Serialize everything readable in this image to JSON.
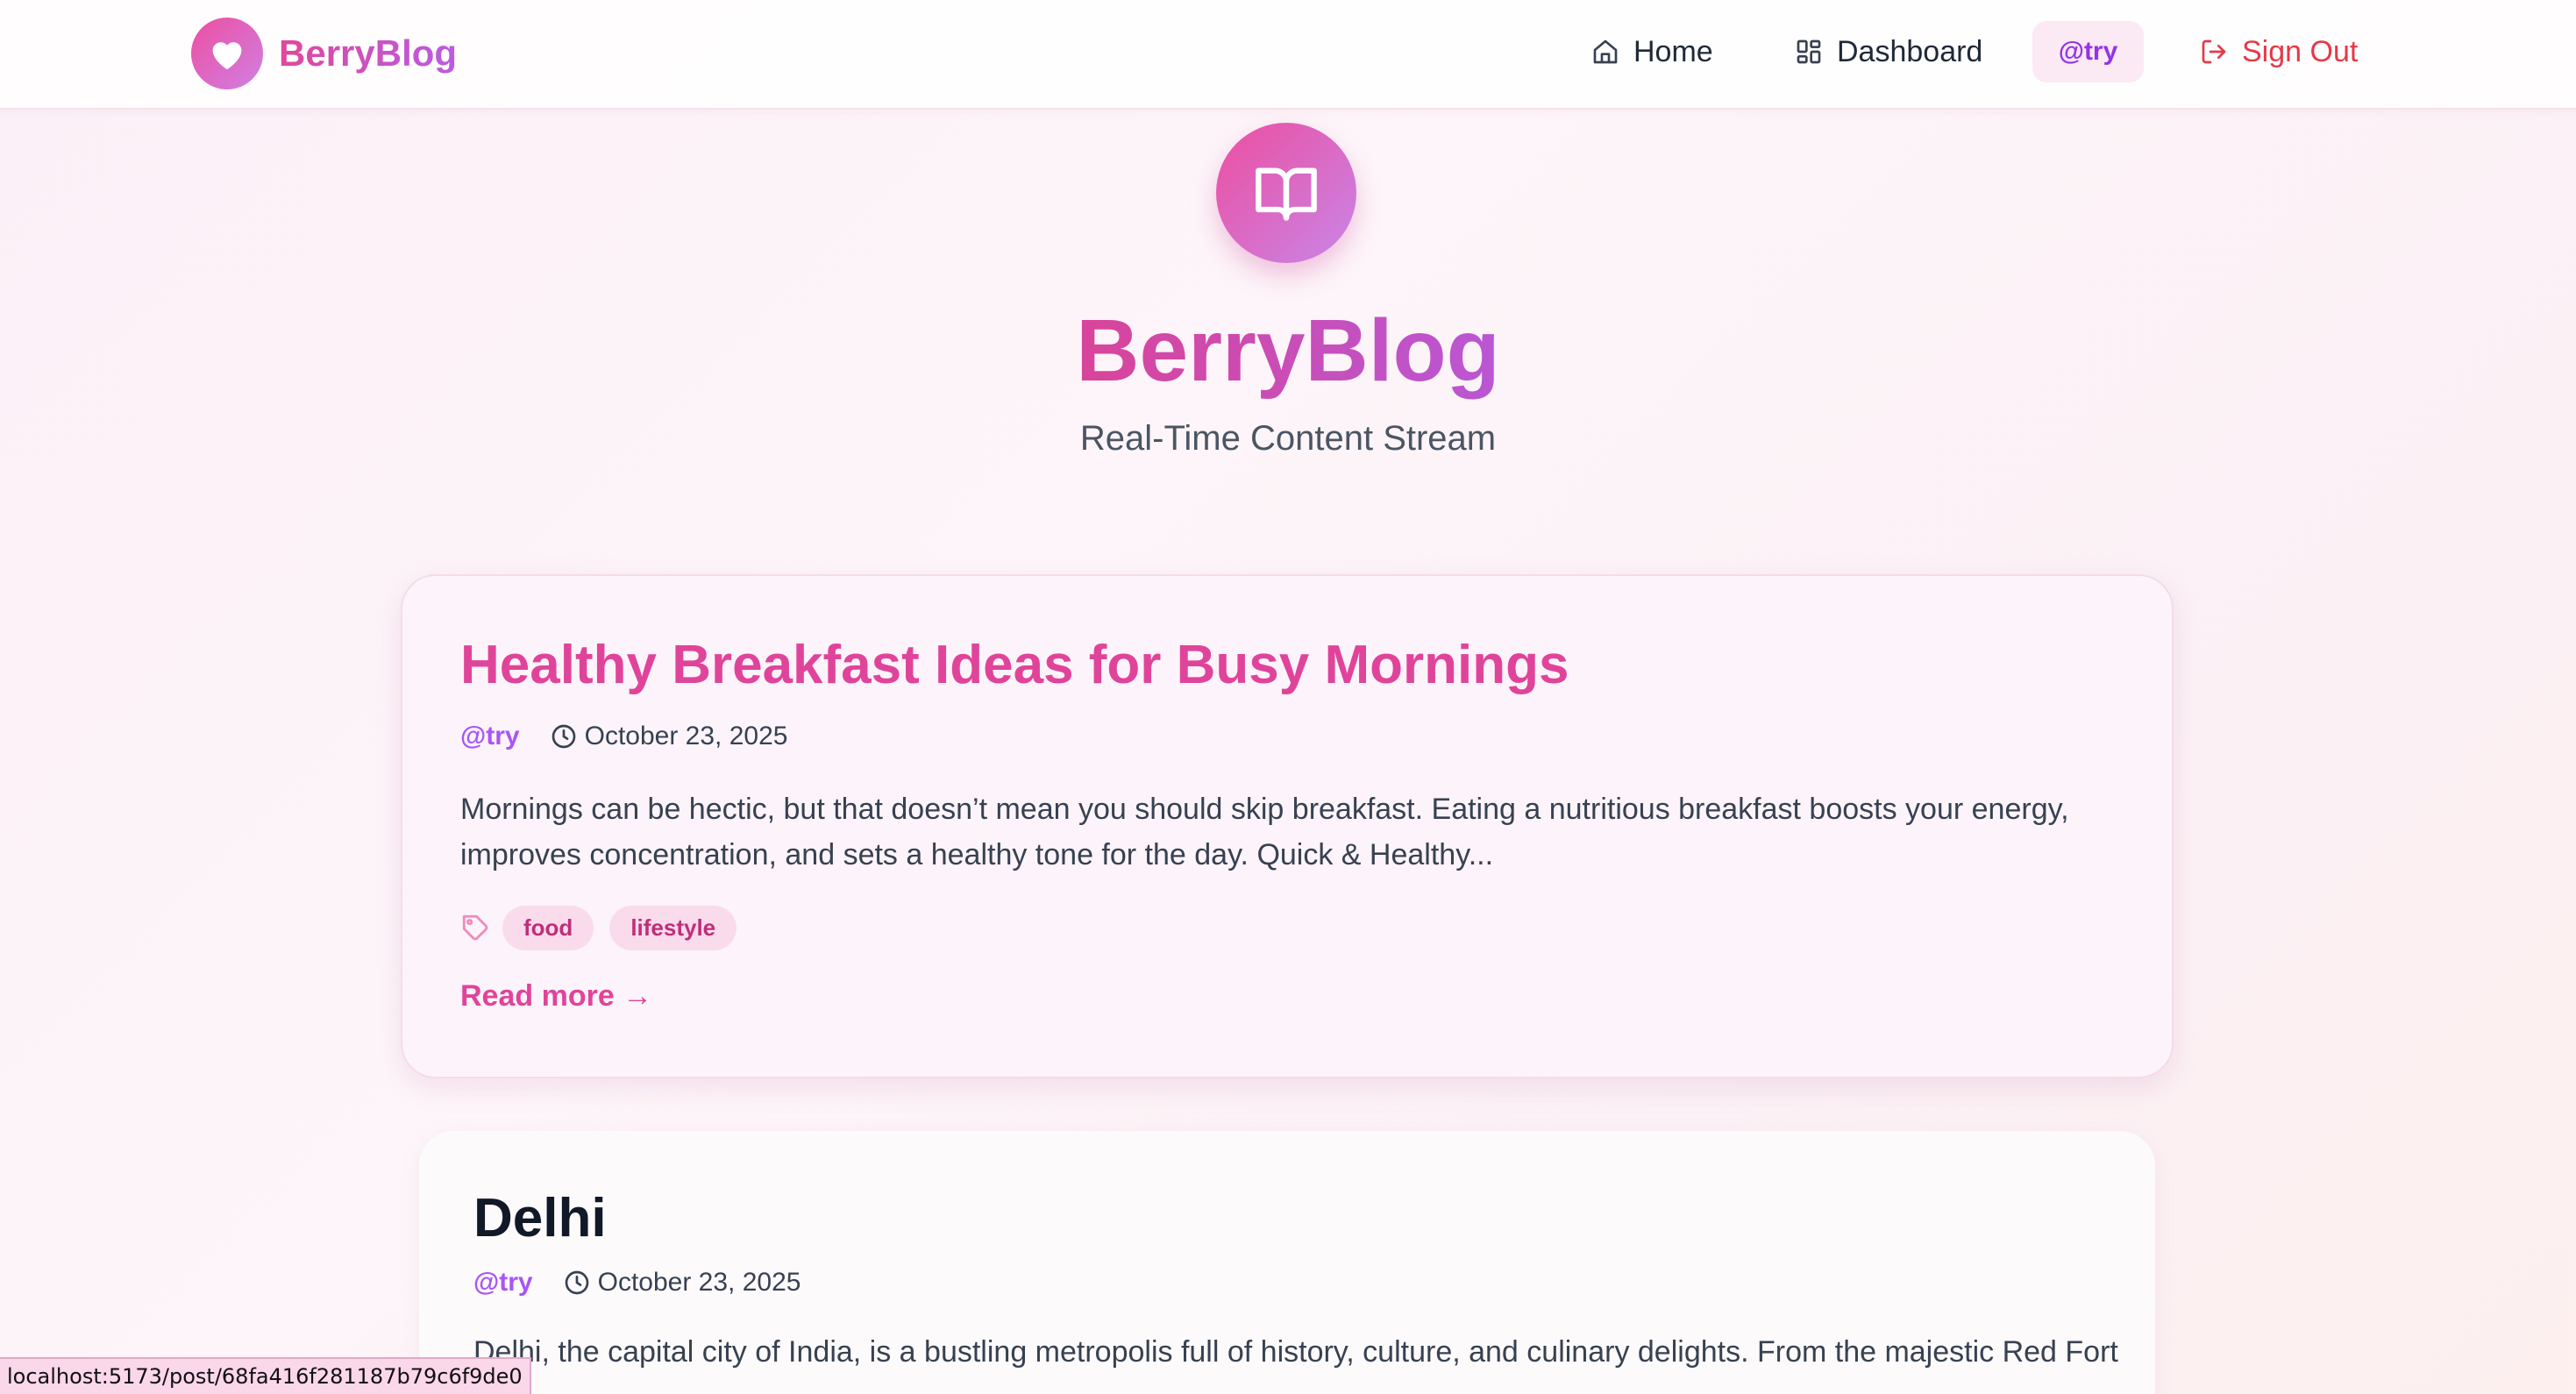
{
  "navbar": {
    "brand": "BerryBlog",
    "home_label": "Home",
    "dashboard_label": "Dashboard",
    "user_label": "@try",
    "signout_label": "Sign Out"
  },
  "hero": {
    "title": "BerryBlog",
    "subtitle": "Real-Time Content Stream"
  },
  "posts": [
    {
      "title": "Healthy Breakfast Ideas for Busy Mornings",
      "author": "@try",
      "date": "October 23, 2025",
      "excerpt": "Mornings can be hectic, but that doesn’t mean you should skip breakfast. Eating a nutritious breakfast boosts your energy, improves concentration, and sets a healthy tone for the day. Quick & Healthy...",
      "tags": [
        "food",
        "lifestyle"
      ],
      "read_more": "Read more →"
    },
    {
      "title": "Delhi",
      "author": "@try",
      "date": "October 23, 2025",
      "excerpt": "Delhi, the capital city of India, is a bustling metropolis full of history, culture, and culinary delights. From the majestic Red Fort to ..."
    }
  ],
  "status_url": "localhost:5173/post/68fa416f281187b79c6f9de0",
  "colors": {
    "accent_pink": "#e0449a",
    "accent_purple": "#a855f7",
    "signout_red": "#e53947"
  }
}
